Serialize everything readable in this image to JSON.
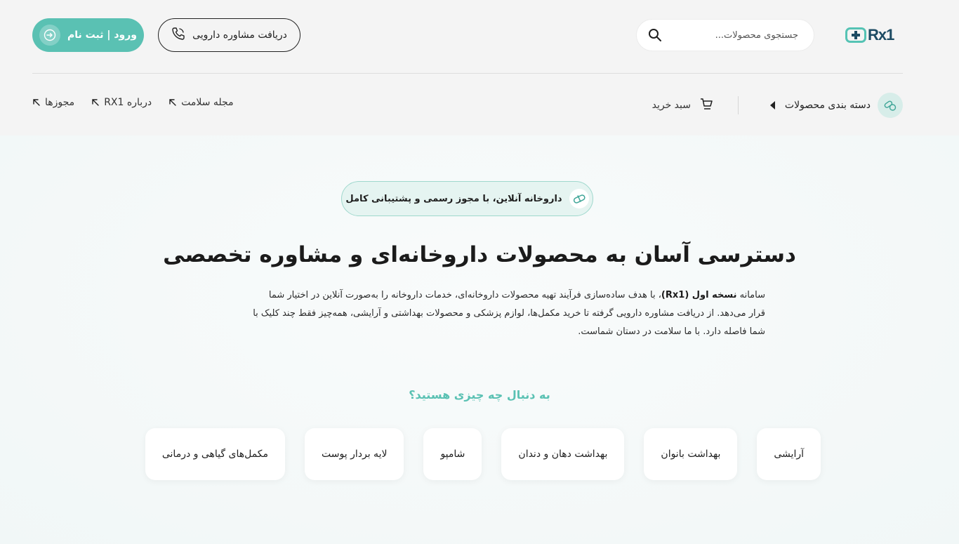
{
  "header": {
    "logo_text": "Rx1",
    "search": {
      "placeholder": "جستجوی محصولات..."
    },
    "consult_label": "دریافت مشاوره دارویی",
    "login_label": "ورود | ثبت نام"
  },
  "nav": {
    "categories_label": "دسته بندی محصولات",
    "cart_label": "سبد خرید",
    "links": [
      {
        "label": "مجله سلامت"
      },
      {
        "label": "درباره RX1"
      },
      {
        "label": "مجوزها"
      }
    ]
  },
  "hero": {
    "badge": "داروخانه آنلاین، با مجوز رسمی و پشتیبانی کامل",
    "title": "دسترسی آسان به محصولات داروخانه‌ای و مشاوره تخصصی",
    "desc_prefix": "سامانه ",
    "desc_brand": "نسخه اول (Rx1)",
    "desc_rest": "، با هدف ساده‌سازی فرآیند تهیه محصولات داروخانه‌ای، خدمات داروخانه را به‌صورت آنلاین در اختیار شما قرار می‌دهد. از دریافت مشاوره دارویی گرفته تا خرید مکمل‌ها، لوازم پزشکی و محصولات بهداشتی و آرایشی، همه‌چیز فقط چند کلیک با شما فاصله دارد. با ما سلامت در دستان شماست.",
    "question": "به دنبال چه چیزی هستید؟",
    "categories": [
      {
        "label": "آرایشی"
      },
      {
        "label": "بهداشت بانوان"
      },
      {
        "label": "بهداشت دهان و دندان"
      },
      {
        "label": "شامپو"
      },
      {
        "label": "لایه بردار پوست"
      },
      {
        "label": "مکمل‌های گیاهی و درمانی"
      }
    ]
  },
  "colors": {
    "accent": "#5ac1b3",
    "dark": "#1d4b63",
    "header_bg": "#f4f4f4",
    "hero_bg": "#f4f9f9"
  }
}
